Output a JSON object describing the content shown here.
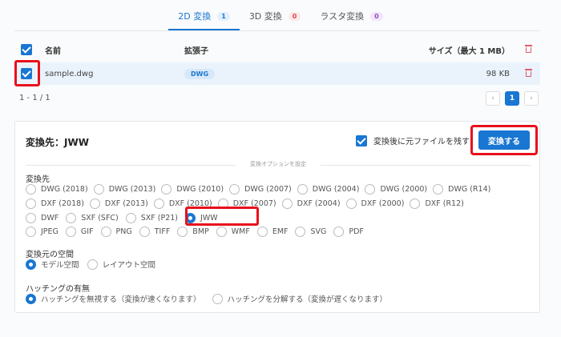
{
  "tabs": [
    {
      "label": "2D 変換",
      "count": "1"
    },
    {
      "label": "3D 変換",
      "count": "0"
    },
    {
      "label": "ラスタ変換",
      "count": "0"
    }
  ],
  "table": {
    "headers": {
      "name": "名前",
      "ext": "拡張子",
      "size": "サイズ（最大 1 MB）"
    },
    "rows": [
      {
        "name": "sample.dwg",
        "ext": "DWG",
        "size": "98 KB"
      }
    ]
  },
  "pagination": {
    "info": "1 - 1 / 1",
    "current": "1",
    "prev": "‹",
    "next": "›"
  },
  "panel": {
    "title": "変換先：JWW",
    "keep_original": "変換後に元ファイルを残す",
    "convert_button": "変換する",
    "options_divider": "変換オプションを設定",
    "target_label": "変換先",
    "target_rows": [
      [
        "DWG (2018)",
        "DWG (2013)",
        "DWG (2010)",
        "DWG (2007)",
        "DWG (2004)",
        "DWG (2000)",
        "DWG (R14)"
      ],
      [
        "DXF (2018)",
        "DXF (2013)",
        "DXF (2010)",
        "DXF (2007)",
        "DXF (2004)",
        "DXF (2000)",
        "DXF (R12)"
      ],
      [
        "DWF",
        "SXF (SFC)",
        "SXF (P21)",
        "JWW"
      ],
      [
        "JPEG",
        "GIF",
        "PNG",
        "TIFF",
        "BMP",
        "WMF",
        "EMF",
        "SVG",
        "PDF"
      ]
    ],
    "selected_target": "JWW",
    "space_label": "変換元の空間",
    "space_options": [
      "モデル空間",
      "レイアウト空間"
    ],
    "selected_space": "モデル空間",
    "hatch_label": "ハッチングの有無",
    "hatch_options": [
      "ハッチングを無視する（変換が速くなります）",
      "ハッチングを分解する（変換が遅くなります）"
    ],
    "selected_hatch": "ハッチングを無視する（変換が速くなります）"
  },
  "colors": {
    "accent": "#1976d2",
    "highlight": "#e8101c"
  }
}
